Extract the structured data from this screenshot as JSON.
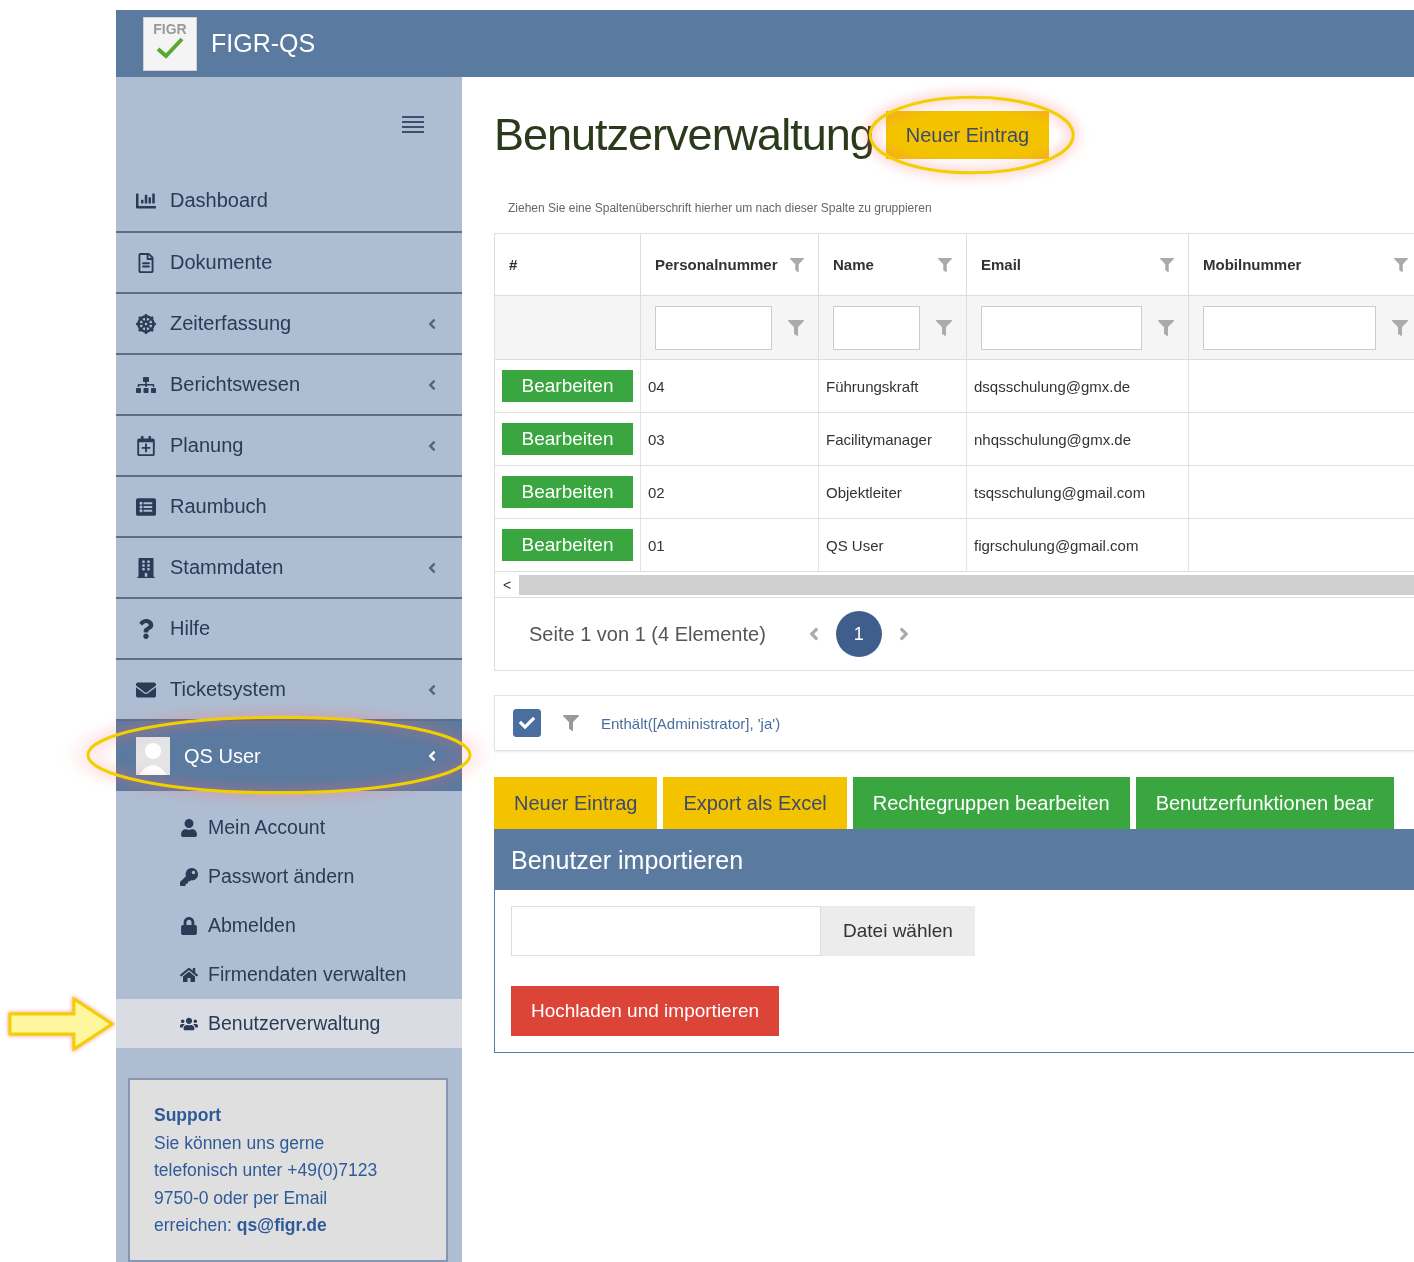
{
  "header": {
    "logo_text": "FIGR",
    "title": "FIGR-QS"
  },
  "sidebar": {
    "items": [
      {
        "label": "Dashboard",
        "selected": false,
        "has_submenu": false
      },
      {
        "label": "Dokumente",
        "selected": false,
        "has_submenu": false
      },
      {
        "label": "Zeiterfassung",
        "selected": false,
        "has_submenu": true
      },
      {
        "label": "Berichtswesen",
        "selected": false,
        "has_submenu": true
      },
      {
        "label": "Planung",
        "selected": false,
        "has_submenu": true
      },
      {
        "label": "Raumbuch",
        "selected": false,
        "has_submenu": false
      },
      {
        "label": "Stammdaten",
        "selected": false,
        "has_submenu": true
      },
      {
        "label": "Hilfe",
        "selected": false,
        "has_submenu": false
      },
      {
        "label": "Ticketsystem",
        "selected": false,
        "has_submenu": true
      },
      {
        "label": "QS User",
        "selected": true,
        "has_submenu": true
      }
    ],
    "submenu": [
      {
        "label": "Mein Account",
        "selected": false
      },
      {
        "label": "Passwort ändern",
        "selected": false
      },
      {
        "label": "Abmelden",
        "selected": false
      },
      {
        "label": "Firmendaten verwalten",
        "selected": false
      },
      {
        "label": "Benutzerverwaltung",
        "selected": true
      }
    ],
    "support": {
      "title": "Support",
      "text": "Sie können uns gerne telefonisch unter +49(0)7123 9750-0 oder per Email erreichen: **qs@figr.de**"
    }
  },
  "page": {
    "title": "Benutzerverwaltung",
    "new_button": "Neuer Eintrag"
  },
  "grid": {
    "group_hint": "Ziehen Sie eine Spaltenüberschrift hierher um nach dieser Spalte zu gruppieren",
    "columns": [
      {
        "label": "#",
        "filterable": false
      },
      {
        "label": "Personalnummer",
        "filterable": true
      },
      {
        "label": "Name",
        "filterable": true
      },
      {
        "label": "Email",
        "filterable": true
      },
      {
        "label": "Mobilnummer",
        "filterable": true
      }
    ],
    "rows": [
      {
        "action": "Bearbeiten",
        "personalnummer": "04",
        "name": "Führungskraft",
        "email": "dsqsschulung@gmx.de"
      },
      {
        "action": "Bearbeiten",
        "personalnummer": "03",
        "name": "Facilitymanager",
        "email": "nhqsschulung@gmx.de"
      },
      {
        "action": "Bearbeiten",
        "personalnummer": "02",
        "name": "Objektleiter",
        "email": "tsqsschulung@gmail.com"
      },
      {
        "action": "Bearbeiten",
        "personalnummer": "01",
        "name": "QS User",
        "email": "figrschulung@gmail.com"
      }
    ],
    "scroll_left": "<",
    "pager": {
      "summary": "Seite 1 von 1 (4 Elemente)",
      "pages": [
        {
          "label": "1",
          "selected": true
        }
      ]
    },
    "filter": {
      "checked": true,
      "expression": "Enthält([Administrator], 'ja')"
    }
  },
  "actions": [
    {
      "label": "Neuer Eintrag",
      "kind": "warning"
    },
    {
      "label": "Export als Excel",
      "kind": "warning"
    },
    {
      "label": "Rechtegruppen bearbeiten",
      "kind": "success"
    },
    {
      "label": "Benutzerfunktionen bear",
      "kind": "success"
    }
  ],
  "import": {
    "title": "Benutzer importieren",
    "choose_button": "Datei wählen",
    "upload_button": "Hochladen und importieren"
  }
}
